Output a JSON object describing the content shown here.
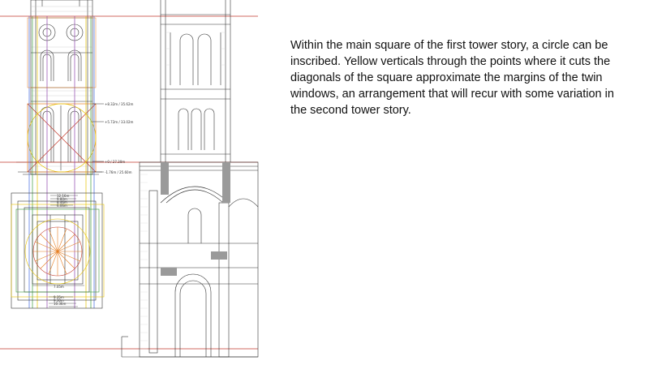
{
  "caption": "Within the main square of the first tower story, a circle can be inscribed.  Yellow verticals through the points where it cuts the diagonals of the square approximate the margins of the twin windows, an arrangement that will recur with some variation in the second tower story.",
  "elevation_labels": [
    "+8.32m / 35.62m",
    "+5.72m / 33.02m",
    "+0 / 27.30m",
    "-1.76m / 25.60m"
  ],
  "plan_labels": {
    "top": [
      "12.16m",
      "9.80m",
      "8.46m",
      "6.06m"
    ],
    "bottom": [
      "7.05m",
      "9.35m",
      "9.30m",
      "10.36m"
    ]
  },
  "colors": {
    "text": "#111111",
    "line": "#333333",
    "red": "#c0392b",
    "yellow": "#e6c200",
    "orange": "#e67e22",
    "green": "#3a9a3a",
    "blue": "#4169e1",
    "purple": "#8e44ad"
  }
}
